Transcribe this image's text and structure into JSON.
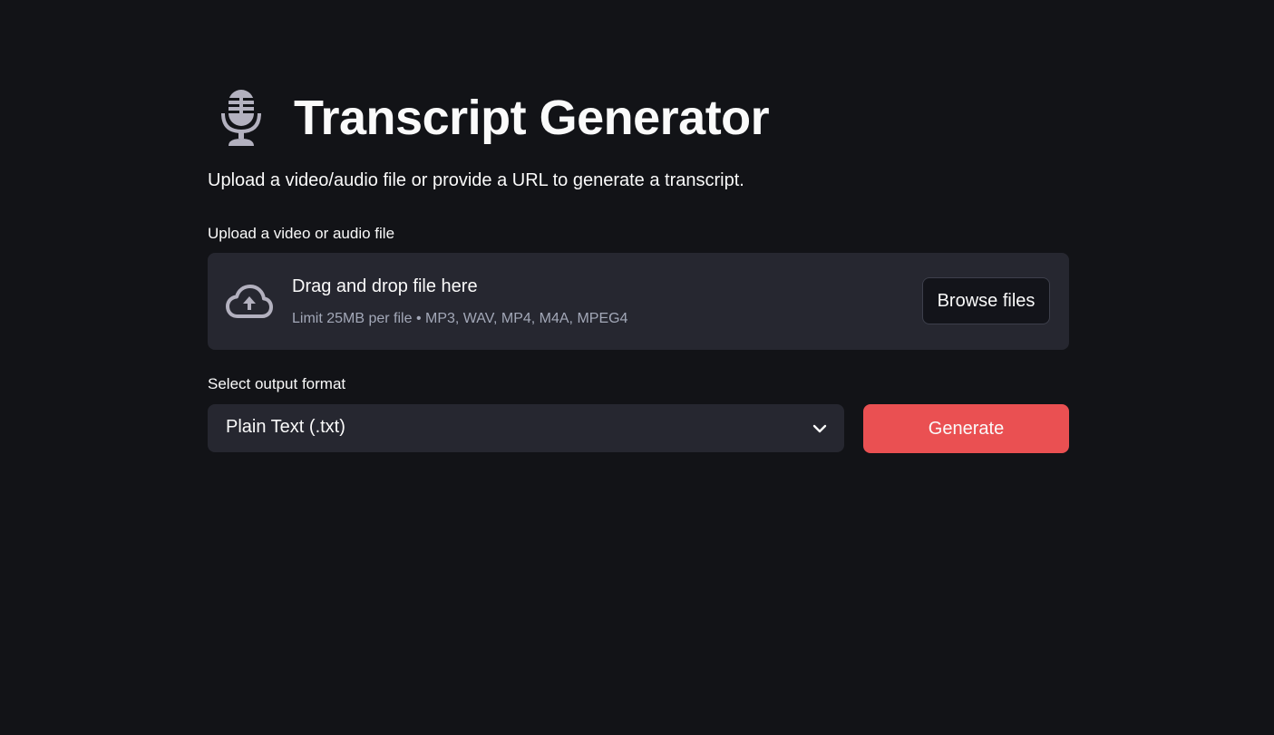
{
  "header": {
    "icon": "microphone-icon",
    "title": "Transcript Generator"
  },
  "subtitle": "Upload a video/audio file or provide a URL to generate a transcript.",
  "uploader": {
    "label": "Upload a video or audio file",
    "icon": "cloud-upload-icon",
    "drop_title": "Drag and drop file here",
    "limit_text": "Limit 25MB per file • MP3, WAV, MP4, M4A, MPEG4",
    "browse_label": "Browse files"
  },
  "format": {
    "label": "Select output format",
    "selected": "Plain Text (.txt)",
    "icon": "chevron-down-icon"
  },
  "generate_label": "Generate",
  "colors": {
    "background": "#121317",
    "panel": "#262730",
    "accent": "#ea5052",
    "muted_text": "#a3a8b8"
  }
}
